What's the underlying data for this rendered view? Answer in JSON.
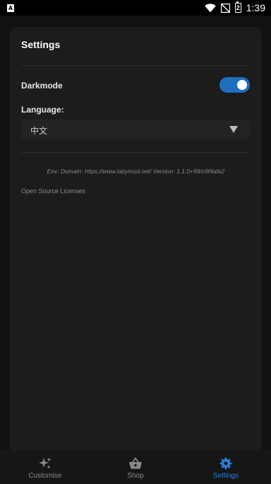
{
  "status_bar": {
    "app_icon_letter": "A",
    "battery_text": "2",
    "time": "1:39"
  },
  "settings": {
    "title": "Settings",
    "darkmode_label": "Darkmode",
    "darkmode_on": true,
    "language_label": "Language:",
    "language_value": "中文",
    "env_text": "Env:  Domain: https://www.labymod.net/ Version: 1.1.0+99/c9f4afa2",
    "licenses_link": "Open Source Licenses"
  },
  "bottom_nav": {
    "items": [
      {
        "label": "Customise",
        "icon": "sparkles-icon",
        "active": false
      },
      {
        "label": "Shop",
        "icon": "basket-icon",
        "active": false
      },
      {
        "label": "Settings",
        "icon": "gear-icon",
        "active": true
      }
    ]
  },
  "colors": {
    "accent": "#2b7fd6",
    "toggle_on": "#1f6fbf",
    "card_bg": "#1c1c1c",
    "page_bg": "#111111"
  }
}
